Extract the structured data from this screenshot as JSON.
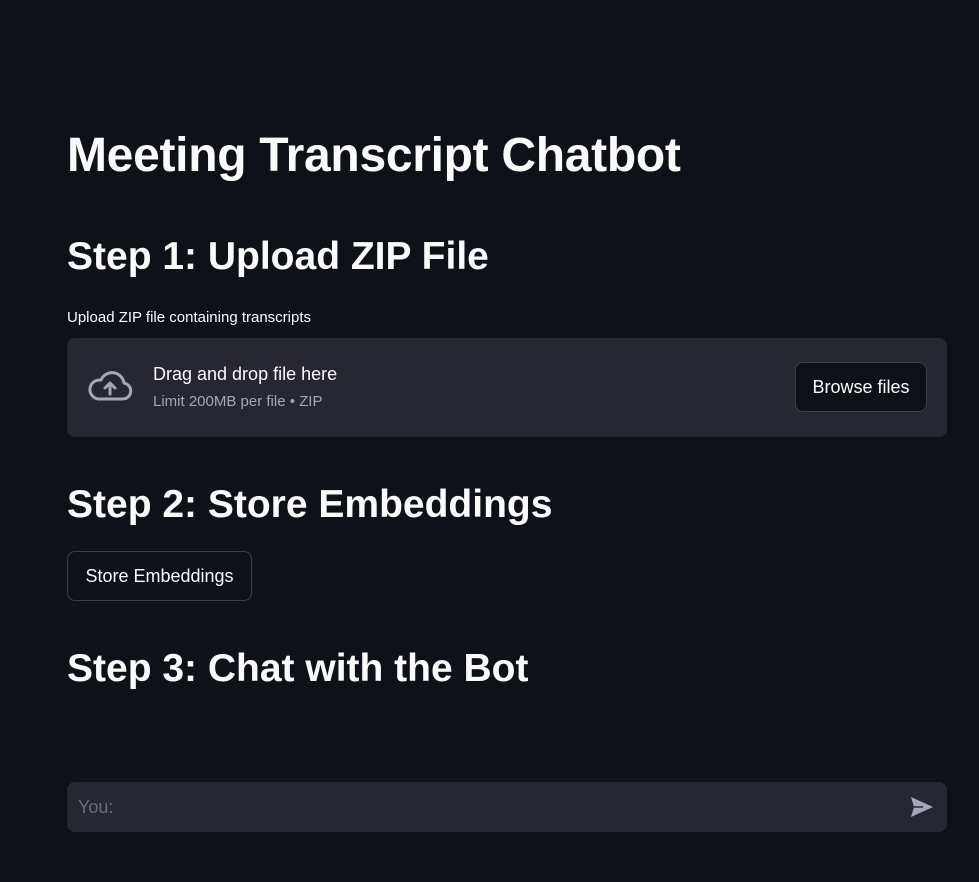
{
  "page": {
    "title": "Meeting Transcript Chatbot"
  },
  "step1": {
    "heading": "Step 1: Upload ZIP File",
    "uploader_label": "Upload ZIP file containing transcripts",
    "dropzone_text": "Drag and drop file here",
    "dropzone_limit": "Limit 200MB per file • ZIP",
    "browse_label": "Browse files"
  },
  "step2": {
    "heading": "Step 2: Store Embeddings",
    "button_label": "Store Embeddings"
  },
  "step3": {
    "heading": "Step 3: Chat with the Bot",
    "input_value": "",
    "input_placeholder": "You:"
  },
  "icons": {
    "upload": "cloud-upload-icon",
    "send": "send-icon"
  },
  "colors": {
    "background": "#0e1117",
    "surface": "#262730",
    "text": "#fafafa",
    "muted": "#a3a8b8"
  }
}
